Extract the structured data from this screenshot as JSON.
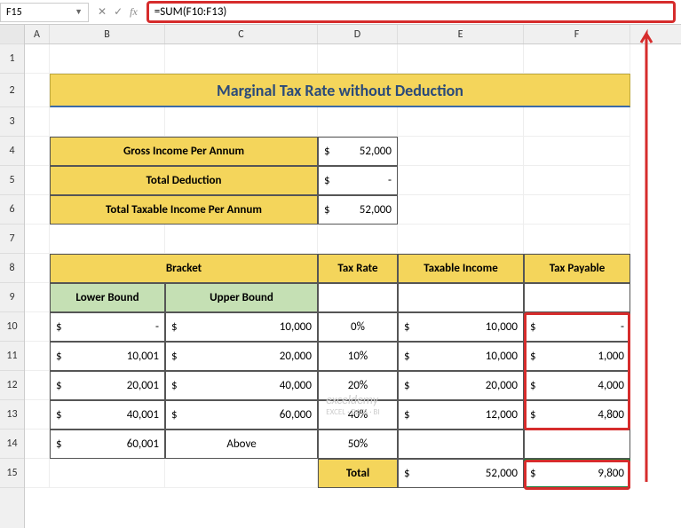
{
  "nameBox": "F15",
  "formula": "=SUM(F10:F13)",
  "cols": [
    "A",
    "B",
    "C",
    "D",
    "E",
    "F"
  ],
  "rows": [
    "1",
    "2",
    "3",
    "4",
    "5",
    "6",
    "7",
    "8",
    "9",
    "10",
    "11",
    "12",
    "13",
    "14",
    "15"
  ],
  "title": "Marginal Tax Rate without Deduction",
  "summary": {
    "r1": {
      "label": "Gross Income Per Annum",
      "cur": "$",
      "val": "52,000"
    },
    "r2": {
      "label": "Total Deduction",
      "cur": "$",
      "val": "-"
    },
    "r3": {
      "label": "Total Taxable Income Per Annum",
      "cur": "$",
      "val": "52,000"
    }
  },
  "head": {
    "bracket": "Bracket",
    "lower": "Lower Bound",
    "upper": "Upper Bound",
    "rate": "Tax Rate",
    "taxable": "Taxable Income",
    "payable": "Tax Payable"
  },
  "data": [
    {
      "lc": "$",
      "lv": "-",
      "uc": "$",
      "uv": "10,000",
      "rate": "0%",
      "tc": "$",
      "tv": "10,000",
      "pc": "$",
      "pv": "-"
    },
    {
      "lc": "$",
      "lv": "10,001",
      "uc": "$",
      "uv": "20,000",
      "rate": "10%",
      "tc": "$",
      "tv": "10,000",
      "pc": "$",
      "pv": "1,000"
    },
    {
      "lc": "$",
      "lv": "20,001",
      "uc": "$",
      "uv": "40,000",
      "rate": "20%",
      "tc": "$",
      "tv": "20,000",
      "pc": "$",
      "pv": "4,000"
    },
    {
      "lc": "$",
      "lv": "40,001",
      "uc": "$",
      "uv": "60,000",
      "rate": "40%",
      "tc": "$",
      "tv": "12,000",
      "pc": "$",
      "pv": "4,800"
    },
    {
      "lc": "$",
      "lv": "60,001",
      "uc": "",
      "uv": "Above",
      "rate": "50%",
      "tc": "",
      "tv": "",
      "pc": "",
      "pv": ""
    }
  ],
  "total": {
    "label": "Total",
    "tc": "$",
    "tv": "52,000",
    "pc": "$",
    "pv": "9,800"
  },
  "watermark": {
    "main": "exceldemy",
    "sub": "EXCEL · DATA · BI"
  }
}
